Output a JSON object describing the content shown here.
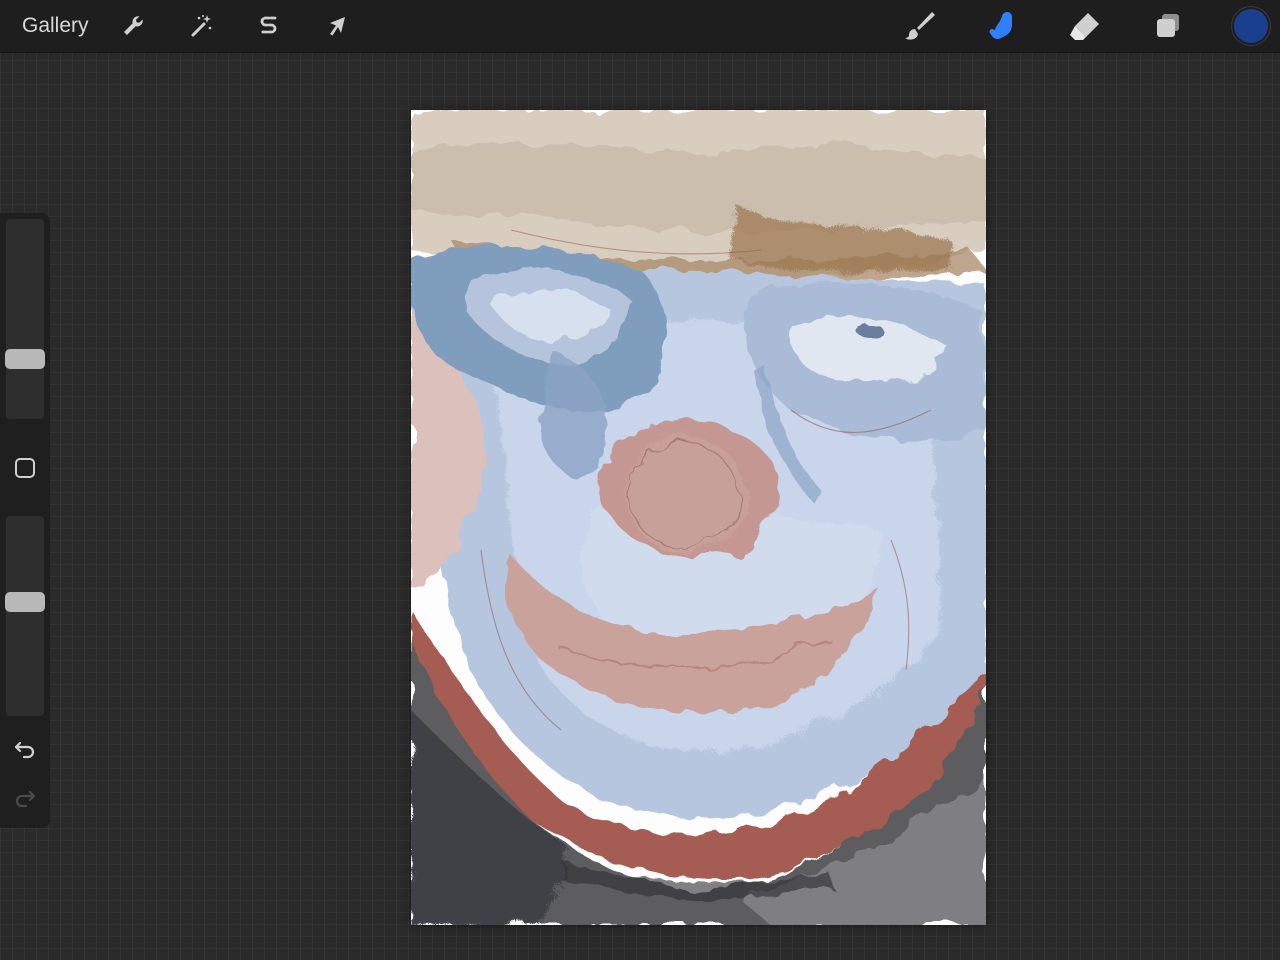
{
  "toolbar": {
    "gallery_label": "Gallery",
    "left_tools": [
      {
        "name": "actions",
        "icon": "wrench-icon"
      },
      {
        "name": "adjustments",
        "icon": "magic-wand-icon"
      },
      {
        "name": "selection",
        "icon": "selection-s-icon"
      },
      {
        "name": "transform",
        "icon": "arrow-cursor-icon"
      }
    ],
    "right_tools": [
      {
        "name": "brush",
        "icon": "brush-icon",
        "active": false
      },
      {
        "name": "smudge",
        "icon": "smudge-finger-icon",
        "active": true
      },
      {
        "name": "eraser",
        "icon": "eraser-icon",
        "active": false
      },
      {
        "name": "layers",
        "icon": "layers-icon",
        "active": false
      }
    ],
    "active_color": "#1b3f8f",
    "active_tool_color": "#2f7fff"
  },
  "sidebar": {
    "brush_size_level": 0.28,
    "opacity_level": 0.58
  },
  "colors": {
    "background": "#2a2a2a",
    "toolbar": "#1e1e1e",
    "icon": "#cfcfcf"
  }
}
